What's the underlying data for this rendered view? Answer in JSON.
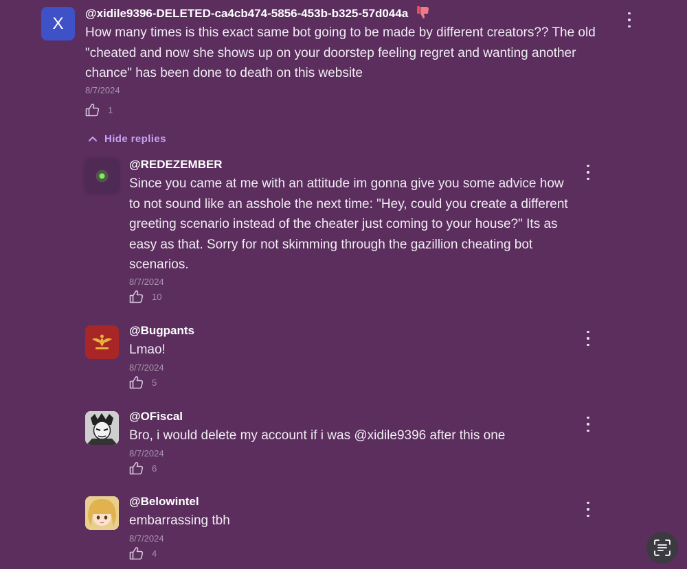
{
  "comments": [
    {
      "username": "@xidile9396-DELETED-ca4cb474-5856-453b-b325-57d044a",
      "avatar_letter": "X",
      "badge": "thumbs-down-emoji",
      "text": "How many times is this exact same bot going to be made by different creators?? The old \"cheated and now she shows up on your doorstep feeling regret and wanting another chance\" has been done to death on this website",
      "date": "8/7/2024",
      "likes": "1"
    }
  ],
  "hide_replies_label": "Hide replies",
  "replies": [
    {
      "username": "@REDEZEMBER",
      "text": "Since you came at me with an attitude im gonna give you some advice how to not sound like an asshole the next time: \"Hey, could you create a different greeting scenario instead of the cheater just coming to your house?\" Its as easy as that. Sorry for not skimming through the gazillion cheating bot scenarios.",
      "date": "8/7/2024",
      "likes": "10"
    },
    {
      "username": "@Bugpants",
      "text": "Lmao!",
      "date": "8/7/2024",
      "likes": "5"
    },
    {
      "username": "@OFiscal",
      "text": "Bro, i would delete my account if i was @xidile9396 after this one",
      "date": "8/7/2024",
      "likes": "6"
    },
    {
      "username": "@Belowintel",
      "text": "embarrassing tbh",
      "date": "8/7/2024",
      "likes": "4"
    }
  ],
  "colors": {
    "background": "#5b2e5e",
    "accent": "#c8a4f6",
    "avatar_x": "#3f51c7"
  },
  "icons": [
    "like-icon",
    "more-options-icon",
    "chevron-up-icon",
    "scan-text-icon"
  ]
}
